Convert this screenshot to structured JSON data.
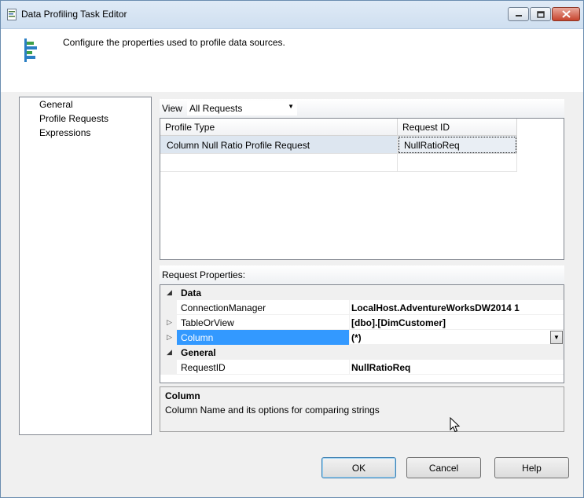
{
  "window": {
    "title": "Data Profiling Task Editor",
    "icons": {
      "title": "document-list-icon",
      "minimize": "minimize-icon",
      "maximize": "maximize-icon",
      "close": "close-icon"
    }
  },
  "header": {
    "description": "Configure the properties used to profile data sources.",
    "icon": "profile-task-icon"
  },
  "nav": {
    "items": [
      {
        "label": "General"
      },
      {
        "label": "Profile Requests"
      },
      {
        "label": "Expressions"
      }
    ]
  },
  "view": {
    "label": "View",
    "selected": "All Requests"
  },
  "requests_grid": {
    "columns": [
      "Profile Type",
      "Request ID"
    ],
    "rows": [
      {
        "profile_type": "Column Null Ratio Profile Request",
        "request_id": "NullRatioReq"
      }
    ]
  },
  "request_properties": {
    "label": "Request Properties:",
    "categories": [
      {
        "name": "Data",
        "properties": [
          {
            "name": "ConnectionManager",
            "value": "LocalHost.AdventureWorksDW2014 1"
          },
          {
            "name": "TableOrView",
            "value": "[dbo].[DimCustomer]"
          },
          {
            "name": "Column",
            "value": "(*)"
          }
        ]
      },
      {
        "name": "General",
        "properties": [
          {
            "name": "RequestID",
            "value": "NullRatioReq"
          }
        ]
      }
    ]
  },
  "description_panel": {
    "title": "Column",
    "text": "Column Name and its options for comparing strings"
  },
  "buttons": {
    "ok": "OK",
    "cancel": "Cancel",
    "help": "Help"
  },
  "colors": {
    "selection": "#3399ff",
    "titlebar": "#dfeaf6",
    "close_button": "#c7432c"
  }
}
